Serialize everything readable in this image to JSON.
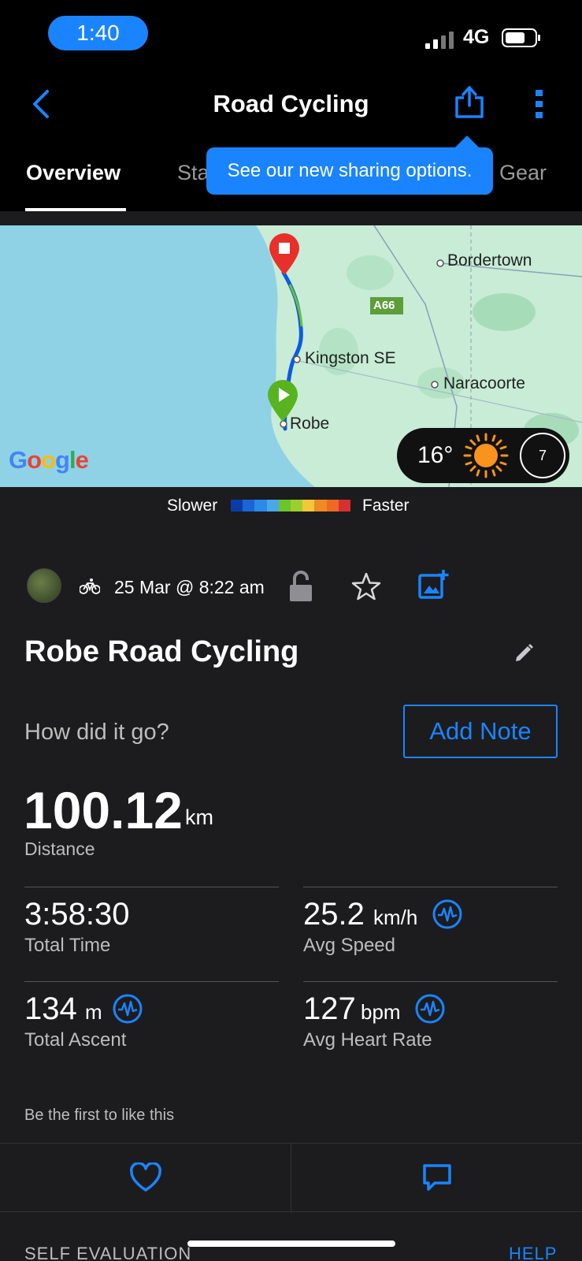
{
  "status_bar": {
    "time": "1:40",
    "network": "4G"
  },
  "nav": {
    "title": "Road Cycling",
    "tabs": [
      {
        "label": "Overview"
      },
      {
        "label": "Sta"
      },
      {
        "label": "Gear"
      }
    ]
  },
  "tooltip": {
    "text": "See our new sharing options."
  },
  "map": {
    "labels": {
      "bordertown": "Bordertown",
      "highway": "A66",
      "kingston": "Kingston SE",
      "naracoorte": "Naracoorte",
      "robe": "Robe"
    },
    "google_logo": "Google",
    "weather": {
      "temperature": "16°",
      "wind": "7"
    },
    "colors": {
      "water": "#8fd2e6",
      "land": "#c8ecd6",
      "route": "#0c5ae8",
      "end_marker": "#e8302a",
      "start_marker": "#57b320"
    }
  },
  "legend": {
    "slow_label": "Slower",
    "fast_label": "Faster",
    "colors": [
      "#0a3ca8",
      "#1a66d6",
      "#2b8ae8",
      "#4aa8e8",
      "#6cc42b",
      "#9ccf2c",
      "#f3c73a",
      "#f08a23",
      "#ee6a24",
      "#d83030"
    ]
  },
  "activity": {
    "date": "25 Mar @ 8:22 am",
    "title": "Robe Road Cycling",
    "prompt": "How did it go?",
    "add_note_label": "Add Note"
  },
  "stats": {
    "distance": {
      "value": "100.12",
      "unit": "km",
      "label": "Distance"
    },
    "total_time": {
      "value": "3:58:30",
      "label": "Total Time"
    },
    "avg_speed": {
      "value": "25.2",
      "unit": "km/h",
      "label": "Avg Speed"
    },
    "total_ascent": {
      "value": "134",
      "unit": "m",
      "label": "Total Ascent"
    },
    "avg_heart_rate": {
      "value": "127",
      "unit": "bpm",
      "label": "Avg Heart Rate"
    }
  },
  "social": {
    "likes_text": "Be the first to like this"
  },
  "footer": {
    "section_label": "SELF EVALUATION",
    "help_label": "HELP"
  },
  "accent_color": "#1a84ff"
}
